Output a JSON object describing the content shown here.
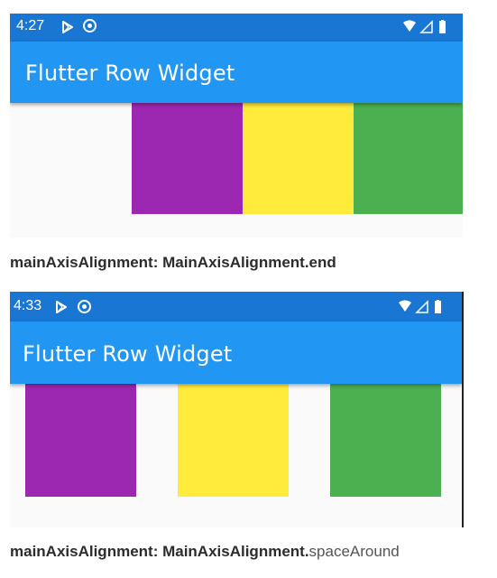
{
  "screens": [
    {
      "status_time": "4:27",
      "app_title": "Flutter Row Widget",
      "boxes": [
        {
          "name": "purple",
          "color": "#9c27b0"
        },
        {
          "name": "yellow",
          "color": "#ffeb3b"
        },
        {
          "name": "green",
          "color": "#4caf50"
        }
      ],
      "caption_bold": "mainAxisAlignment: MainAxisAlignment.end",
      "caption_normal": ""
    },
    {
      "status_time": "4:33",
      "app_title": "Flutter Row Widget",
      "boxes": [
        {
          "name": "purple",
          "color": "#9c27b0"
        },
        {
          "name": "yellow",
          "color": "#ffeb3b"
        },
        {
          "name": "green",
          "color": "#4caf50"
        }
      ],
      "caption_bold": "mainAxisAlignment: MainAxisAlignment.",
      "caption_normal": "spaceAround"
    }
  ],
  "colors": {
    "status_bar": "#1976d2",
    "app_bar": "#2196f3",
    "background": "#fafafa"
  },
  "icons": [
    "play-store-icon",
    "sync-icon",
    "wifi-icon",
    "signal-icon",
    "battery-icon"
  ]
}
